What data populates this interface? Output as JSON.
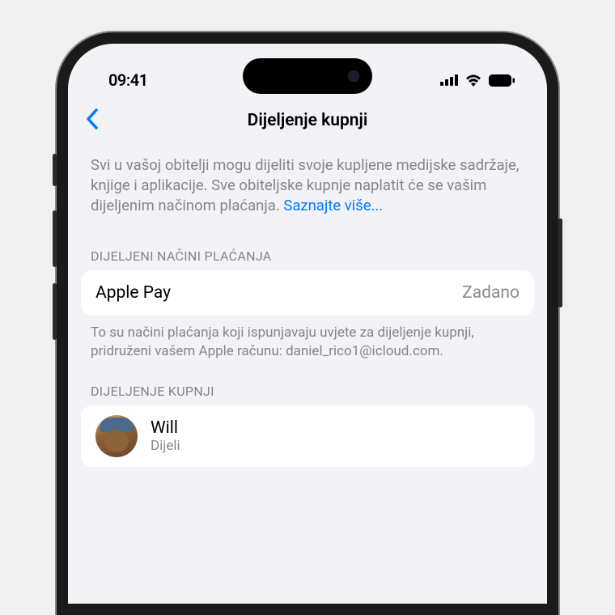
{
  "status_bar": {
    "time": "09:41"
  },
  "nav": {
    "title": "Dijeljenje kupnji"
  },
  "intro": {
    "text": "Svi u vašoj obitelji mogu dijeliti svoje kupljene medijske sadržaje, knjige i aplikacije. Sve obiteljske kupnje naplatit će se vašim dijeljenim načinom plaćanja. ",
    "link": "Saznajte više..."
  },
  "payment_section": {
    "header": "DIJELJENI NAČINI PLAĆANJA",
    "method": "Apple Pay",
    "status": "Zadano",
    "footer": "To su načini plaćanja koji ispunjavaju uvjete za dijeljenje kupnji, pridruženi vašem Apple računu: daniel_rico1@icloud.com."
  },
  "sharing_section": {
    "header": "DIJELJENJE KUPNJI",
    "users": [
      {
        "name": "Will",
        "status": "Dijeli"
      }
    ]
  },
  "colors": {
    "link": "#007aff",
    "secondary_text": "#868689",
    "background": "#f2f2f7"
  }
}
